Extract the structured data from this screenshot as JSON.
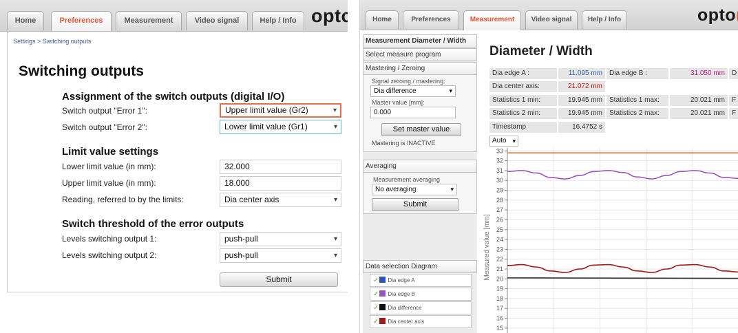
{
  "left_panel": {
    "tabs": [
      "Home",
      "Preferences",
      "Measurement",
      "Video signal",
      "Help / Info"
    ],
    "active_tab": "Preferences",
    "brand": "opto",
    "breadcrumb": "Settings > Switching outputs",
    "title": "Switching outputs",
    "assignment": {
      "heading": "Assignment of the switch outputs (digital I/O)",
      "error1_label": "Switch output \"Error 1\":",
      "error1_value": "Upper limit value (Gr2)",
      "error2_label": "Switch output \"Error 2\":",
      "error2_value": "Lower limit value (Gr1)"
    },
    "limits": {
      "heading": "Limit value settings",
      "lower_label": "Lower limit value (in mm):",
      "lower_value": "32.000",
      "upper_label": "Upper limit value (in mm):",
      "upper_value": "18.000",
      "reading_label": "Reading, referred to by the limits:",
      "reading_value": "Dia center axis"
    },
    "threshold": {
      "heading": "Switch threshold of the error outputs",
      "level1_label": "Levels switching output 1:",
      "level1_value": "push-pull",
      "level2_label": "Levels switching output 2:",
      "level2_value": "push-pull"
    },
    "submit_label": "Submit"
  },
  "right_panel": {
    "tabs": [
      "Home",
      "Preferences",
      "Measurement",
      "Video signal",
      "Help / Info"
    ],
    "active_tab": "Measurement",
    "brand": "opto",
    "brand_accent": "(",
    "sidebar": {
      "items": [
        "Measurement Diameter / Width",
        "Select measure program",
        "Mastering / Zeroing"
      ],
      "signal_zeroing_label": "Signal zeroing / mastering:",
      "signal_zeroing_value": "Dia difference",
      "master_value_label": "Master value [mm]:",
      "master_value": "0.000",
      "set_master_button": "Set master value",
      "mastering_status": "Mastering is INACTIVE",
      "averaging_header": "Averaging",
      "averaging_label": "Measurement averaging",
      "averaging_value": "No averaging",
      "averaging_submit": "Submit",
      "data_selection_header": "Data selection Diagram",
      "legend": [
        {
          "label": "Dia edge A",
          "color": "#2e56b0"
        },
        {
          "label": "Dia edge B",
          "color": "#9a55b8"
        },
        {
          "label": "Dia difference",
          "color": "#111111"
        },
        {
          "label": "Dia center axis",
          "color": "#9e1a1a"
        }
      ]
    },
    "main": {
      "title": "Diameter / Width",
      "values": {
        "edge_a_label": "Dia edge A :",
        "edge_a_value": "11.095 mm",
        "edge_b_label": "Dia edge B :",
        "edge_b_value": "31.050 mm",
        "edge_b_trailing": "D",
        "center_label": "Dia center axis:",
        "center_value": "21.072 mm",
        "stat1_min_label": "Statistics 1 min:",
        "stat1_min_value": "19.945 mm",
        "stat1_max_label": "Statistics 1 max:",
        "stat1_max_value": "20.021 mm",
        "stat1_trailing": "F",
        "stat2_min_label": "Statistics 2 min:",
        "stat2_min_value": "19.945 mm",
        "stat2_max_label": "Statistics 2 max:",
        "stat2_max_value": "20.021 mm",
        "stat2_trailing": "F",
        "timestamp_label": "Timestamp",
        "timestamp_value": "16.4752 s"
      },
      "auto_select": "Auto"
    }
  },
  "chart_data": {
    "type": "line",
    "ylabel": "Measured value [mm]",
    "ylim": [
      14.5,
      33.3
    ],
    "y_ticks": [
      15,
      16,
      17,
      18,
      19,
      20,
      21,
      22,
      23,
      24,
      25,
      26,
      27,
      28,
      29,
      30,
      31,
      32,
      33
    ],
    "grid": true,
    "series": [
      {
        "color": "#e8743b",
        "x": [
          0,
          50,
          100
        ],
        "values": [
          32.8,
          32.8,
          32.8
        ]
      },
      {
        "color": "#9a55b8",
        "x": [
          0,
          6.25,
          12.5,
          18.75,
          25,
          31.25,
          37.5,
          43.75,
          50,
          56.25,
          62.5,
          68.75,
          75,
          81.25,
          87.5,
          93.75,
          100
        ],
        "values": [
          30.9,
          31.0,
          30.75,
          30.3,
          30.15,
          30.5,
          30.9,
          31.0,
          30.8,
          30.35,
          30.15,
          30.5,
          30.9,
          31.0,
          30.75,
          30.3,
          30.2
        ]
      },
      {
        "color": "#9e1a1a",
        "x": [
          0,
          6.25,
          12.5,
          18.75,
          25,
          31.25,
          37.5,
          43.75,
          50,
          56.25,
          62.5,
          68.75,
          75,
          81.25,
          87.5,
          93.75,
          100
        ],
        "values": [
          21.35,
          21.45,
          21.2,
          20.8,
          20.65,
          21.0,
          21.4,
          21.45,
          21.2,
          20.8,
          20.65,
          21.0,
          21.4,
          21.45,
          21.2,
          20.8,
          20.7
        ]
      },
      {
        "color": "#333333",
        "x": [
          0,
          100
        ],
        "values": [
          20.1,
          20.05
        ]
      }
    ]
  }
}
